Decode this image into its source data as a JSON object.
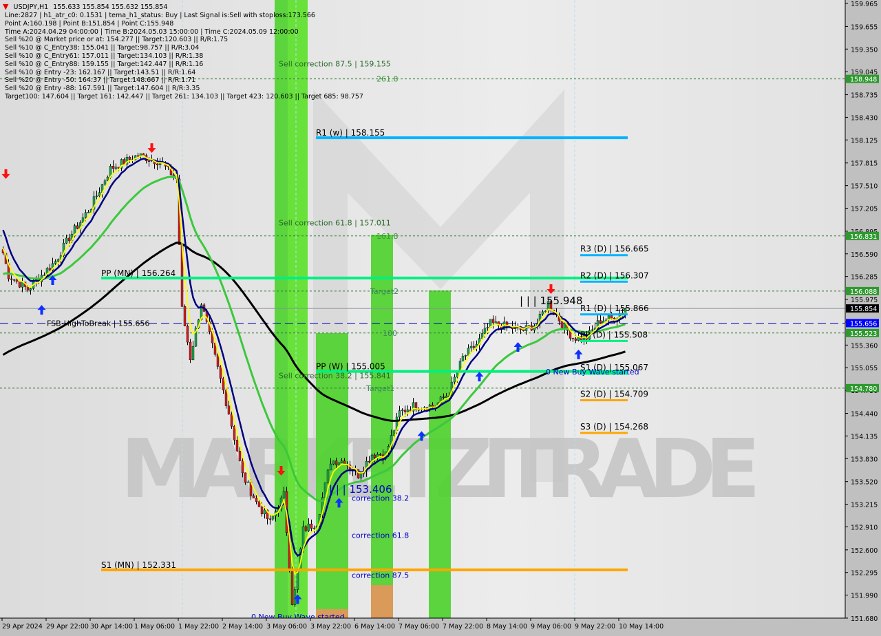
{
  "header": {
    "symbol": "USDJPY,H1",
    "ohlc": "155.633 155.854 155.632 155.854",
    "info_lines": [
      "Line:2827 | h1_atr_c0: 0.1531 | tema_h1_status: Buy | Last Signal is:Sell with stoploss:173.566",
      "Point A:160.198 | Point B:151.854 | Point C:155.948",
      "Time A:2024.04.29 04:00:00 | Time B:2024.05.03 15:00:00 | Time C:2024.05.09 12:00:00",
      "Sell %20 @ Market price or at: 154.277 || Target:120.603 || R/R:1.75",
      "Sell %10 @ C_Entry38: 155.041 || Target:98.757 || R/R:3.04",
      "Sell %10 @ C_Entry61: 157.011 || Target:134.103 || R/R:1.38",
      "Sell %10 @ C_Entry88: 159.155 || Target:142.447 || R/R:1.16",
      "Sell %10 @ Entry -23: 162.167 || Target:143.51 || R/R:1.64",
      "Sell %20 @ Entry -50: 164.37 || Target:148.667 || R/R:1.71",
      "Sell %20 @ Entry -88: 167.591 || Target:147.604 || R/R:3.35",
      "Target100: 147.604 || Target 161: 142.447 || Target 261: 134.103 || Target 423: 120.603 || Target 685: 98.757"
    ]
  },
  "watermark": "MARKETZITRADE",
  "chart_data": {
    "type": "candlestick",
    "symbol": "USDJPY",
    "timeframe": "H1",
    "ylim": [
      151.68,
      159.965
    ],
    "y_ticks": [
      "159.965",
      "159.655",
      "159.350",
      "159.045",
      "158.735",
      "158.430",
      "158.125",
      "157.815",
      "157.510",
      "157.205",
      "156.895",
      "156.590",
      "156.285",
      "155.975",
      "155.670",
      "155.360",
      "155.055",
      "154.750",
      "154.440",
      "154.135",
      "153.830",
      "153.520",
      "153.215",
      "152.910",
      "152.600",
      "152.295",
      "151.990",
      "151.680"
    ],
    "x_ticks": [
      "29 Apr 2024",
      "29 Apr 22:00",
      "30 Apr 14:00",
      "1 May 06:00",
      "1 May 22:00",
      "2 May 14:00",
      "3 May 06:00",
      "3 May 22:00",
      "6 May 14:00",
      "7 May 06:00",
      "7 May 22:00",
      "8 May 14:00",
      "9 May 06:00",
      "9 May 22:00",
      "10 May 14:00"
    ],
    "first_bar": "2024-04-29 06:00",
    "close_path": [
      [
        "2024-04-29 06:00",
        156.6
      ],
      [
        "2024-04-29 08:00",
        156.3
      ],
      [
        "2024-04-29 15:00",
        156.11
      ],
      [
        "2024-04-30 01:00",
        156.49
      ],
      [
        "2024-04-30 06:00",
        156.81
      ],
      [
        "2024-04-30 14:00",
        157.23
      ],
      [
        "2024-04-30 21:00",
        157.74
      ],
      [
        "2024-05-01 07:00",
        157.92
      ],
      [
        "2024-05-01 15:00",
        157.83
      ],
      [
        "2024-05-01 21:00",
        157.6
      ],
      [
        "2024-05-01 23:00",
        155.84
      ],
      [
        "2024-05-02 02:00",
        155.19
      ],
      [
        "2024-05-02 06:00",
        155.93
      ],
      [
        "2024-05-02 11:00",
        155.19
      ],
      [
        "2024-05-02 16:00",
        154.45
      ],
      [
        "2024-05-02 21:00",
        153.61
      ],
      [
        "2024-05-03 02:00",
        153.24
      ],
      [
        "2024-05-03 07:00",
        152.97
      ],
      [
        "2024-05-03 12:00",
        153.34
      ],
      [
        "2024-05-03 15:00",
        151.9
      ],
      [
        "2024-05-03 16:00",
        152.04
      ],
      [
        "2024-05-03 19:00",
        152.87
      ],
      [
        "2024-05-06 00:00",
        152.97
      ],
      [
        "2024-05-06 05:00",
        153.8
      ],
      [
        "2024-05-06 10:00",
        153.8
      ],
      [
        "2024-05-06 15:00",
        153.61
      ],
      [
        "2024-05-06 20:00",
        153.89
      ],
      [
        "2024-05-07 01:00",
        153.89
      ],
      [
        "2024-05-07 06:00",
        154.45
      ],
      [
        "2024-05-07 11:00",
        154.54
      ],
      [
        "2024-05-07 19:00",
        154.54
      ],
      [
        "2024-05-08 00:00",
        154.72
      ],
      [
        "2024-05-08 05:00",
        155.19
      ],
      [
        "2024-05-08 10:00",
        155.37
      ],
      [
        "2024-05-08 15:00",
        155.65
      ],
      [
        "2024-05-08 22:00",
        155.6
      ],
      [
        "2024-05-09 03:00",
        155.56
      ],
      [
        "2024-05-09 08:00",
        155.65
      ],
      [
        "2024-05-09 12:00",
        155.93
      ],
      [
        "2024-05-09 17:00",
        155.65
      ],
      [
        "2024-05-09 21:00",
        155.46
      ],
      [
        "2024-05-10 02:00",
        155.46
      ],
      [
        "2024-05-10 07:00",
        155.7
      ],
      [
        "2024-05-10 12:00",
        155.72
      ],
      [
        "2024-05-10 16:00",
        155.854
      ]
    ],
    "price_badges": [
      {
        "value": "158.948",
        "color": "#2e9a2e"
      },
      {
        "value": "156.831",
        "color": "#2e9a2e"
      },
      {
        "value": "156.088",
        "color": "#2e9a2e"
      },
      {
        "value": "155.854",
        "color": "#000000"
      },
      {
        "value": "155.656",
        "color": "#0000ff"
      },
      {
        "value": "155.523",
        "color": "#2e9a2e"
      },
      {
        "value": "154.780",
        "color": "#2e9a2e"
      }
    ],
    "levels": [
      {
        "label": "R1 (w) | 158.155",
        "value": 158.155,
        "color": "#00b4ff",
        "from": "2024-05-04 00:00"
      },
      {
        "label": "PP (MN) | 156.264",
        "value": 156.264,
        "color": "#00f080",
        "from": "2024-04-30 18:00"
      },
      {
        "label": "PP (W) | 155.005",
        "value": 155.005,
        "color": "#00f080",
        "from": "2024-05-04 00:00"
      },
      {
        "label": "S1 (MN) | 152.331",
        "value": 152.331,
        "color": "#ffa500",
        "from": "2024-04-30 18:00"
      },
      {
        "label": "R3 (D) | 156.665",
        "value": 156.665,
        "color": "#00b4ff",
        "from": "2024-05-10 00:00"
      },
      {
        "label": "R2 (D) | 156.307",
        "value": 156.307,
        "color": "#00b4ff",
        "from": "2024-05-10 00:00"
      },
      {
        "label": "R1 (D) | 155.866",
        "value": 155.866,
        "color": "#00b4ff",
        "from": "2024-05-10 00:00"
      },
      {
        "label": "PP (D) | 155.508",
        "value": 155.508,
        "color": "#00f080",
        "from": "2024-05-10 00:00"
      },
      {
        "label": "S1 (D) | 155.067",
        "value": 155.067,
        "color": "#00f080",
        "from": "2024-05-10 00:00"
      },
      {
        "label": "S2 (D) | 154.709",
        "value": 154.709,
        "color": "#ffa500",
        "from": "2024-05-10 00:00"
      },
      {
        "label": "S3 (D) | 154.268",
        "value": 154.268,
        "color": "#ffa500",
        "from": "2024-05-10 00:00"
      }
    ],
    "annotations": [
      {
        "text": "Sell correction 87.5 | 159.155",
        "value": 159.155,
        "color": "#2a6a2a"
      },
      {
        "text": "261.8",
        "value": 158.948,
        "color": "#3a9a3a"
      },
      {
        "text": "Sell correction 61.8 | 157.011",
        "value": 157.011,
        "color": "#2a6a2a"
      },
      {
        "text": "161.8",
        "value": 156.831,
        "color": "#3a9a3a"
      },
      {
        "text": "Target2",
        "value": 156.088,
        "color": "#3a8a5a"
      },
      {
        "text": "100",
        "value": 155.523,
        "color": "#3a8a5a"
      },
      {
        "text": "Sell correction 38.2 | 155.841",
        "value": 154.95,
        "color": "#2a6a2a"
      },
      {
        "text": "Target1",
        "value": 154.78,
        "color": "#3a8a5a"
      },
      {
        "text": "| | | 155.948",
        "value": 155.948,
        "color": "#000000"
      },
      {
        "text": "| | | 153.406",
        "value": 153.406,
        "color": "#0000cc"
      },
      {
        "text": "correction 38.2",
        "value": 153.3,
        "color": "#0000cc"
      },
      {
        "text": "correction 61.8",
        "value": 152.8,
        "color": "#0000cc"
      },
      {
        "text": "correction 87.5",
        "value": 152.26,
        "color": "#0000cc"
      },
      {
        "text": "0 New Buy Wave started",
        "value": 155.0,
        "color": "#0000cc"
      },
      {
        "text": "0 New Buy Wave started",
        "value": 151.7,
        "color": "#0000cc"
      },
      {
        "text": "FSB-HighToBreak | 155.656",
        "value": 155.656,
        "color": "#000000"
      }
    ],
    "signals": [
      {
        "type": "buy",
        "time": "2024-04-29 20:00",
        "price": 155.9
      },
      {
        "type": "buy",
        "time": "2024-04-30 00:00",
        "price": 156.3
      },
      {
        "type": "sell",
        "time": "2024-04-29 07:00",
        "price": 157.6
      },
      {
        "type": "sell",
        "time": "2024-05-01 12:00",
        "price": 157.95
      },
      {
        "type": "sell",
        "time": "2024-05-03 11:00",
        "price": 153.6
      },
      {
        "type": "buy",
        "time": "2024-05-03 17:00",
        "price": 152.0
      },
      {
        "type": "buy",
        "time": "2024-05-06 08:00",
        "price": 153.3
      },
      {
        "type": "buy",
        "time": "2024-05-07 14:00",
        "price": 154.2
      },
      {
        "type": "buy",
        "time": "2024-05-08 11:00",
        "price": 155.0
      },
      {
        "type": "buy",
        "time": "2024-05-09 01:00",
        "price": 155.4
      },
      {
        "type": "sell",
        "time": "2024-05-09 13:00",
        "price": 156.05
      },
      {
        "type": "buy",
        "time": "2024-05-09 23:00",
        "price": 155.3
      }
    ],
    "colors": {
      "bull": "#1fa84f",
      "bear": "#d21f1f",
      "ema_fast": "#ffff00",
      "ema_mid": "#00007f",
      "ema_slow": "#3cc83c",
      "ema_long": "#000000",
      "zones": "#4cd12a",
      "zone_light": "#6ee83a",
      "zone_orange": "#d99a5a"
    }
  }
}
